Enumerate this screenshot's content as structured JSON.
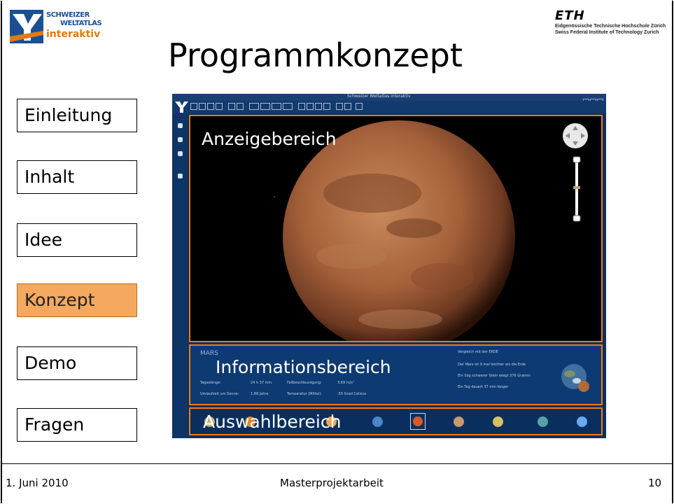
{
  "header": {
    "logo_left": {
      "line1": "SCHWEIZER",
      "line2": "WELTATLAS",
      "line3": "interaktiv"
    },
    "logo_right": {
      "brand": "ETH",
      "line1": "Eidgenössische Technische Hochschule Zürich",
      "line2": "Swiss Federal Institute of Technology Zurich"
    },
    "title": "Programmkonzept"
  },
  "nav": {
    "items": [
      "Einleitung",
      "Inhalt",
      "Idee",
      "Konzept",
      "Demo",
      "Fragen"
    ],
    "active": "Konzept"
  },
  "screenshot": {
    "window_title": "Schweizer Weltatlas interaktiv",
    "display_label": "Anzeigebereich",
    "info_label": "Informationsbereich",
    "selection_label": "Auswahlbereich",
    "info": {
      "planet": "MARS",
      "rows": [
        {
          "k1": "Tageslänge:",
          "v1": "24 h 37 min",
          "k2": "Fallbeschleunigung:",
          "v2": "3.69 m/s²"
        },
        {
          "k1": "Umlaufzeit um Sonne:",
          "v1": "1.88 Jahre",
          "k2": "Temperatur (Mittel):",
          "v2": "-55 Grad Celsius"
        }
      ],
      "compare_title": "Vergleich mit der ERDE",
      "compare": [
        "Der Mars ist 9 mal leichter als die Erde",
        "Ein 1kg schwerer Stein wiegt 376 Gramm",
        "Ein Tag dauert 37 min länger"
      ]
    }
  },
  "footer": {
    "date": "1. Juni 2010",
    "center": "Masterprojektarbeit",
    "page": "10"
  },
  "colors": {
    "accent": "#f07c14",
    "active_nav": "#f4a95f",
    "app_blue": "#0a2f5e"
  }
}
